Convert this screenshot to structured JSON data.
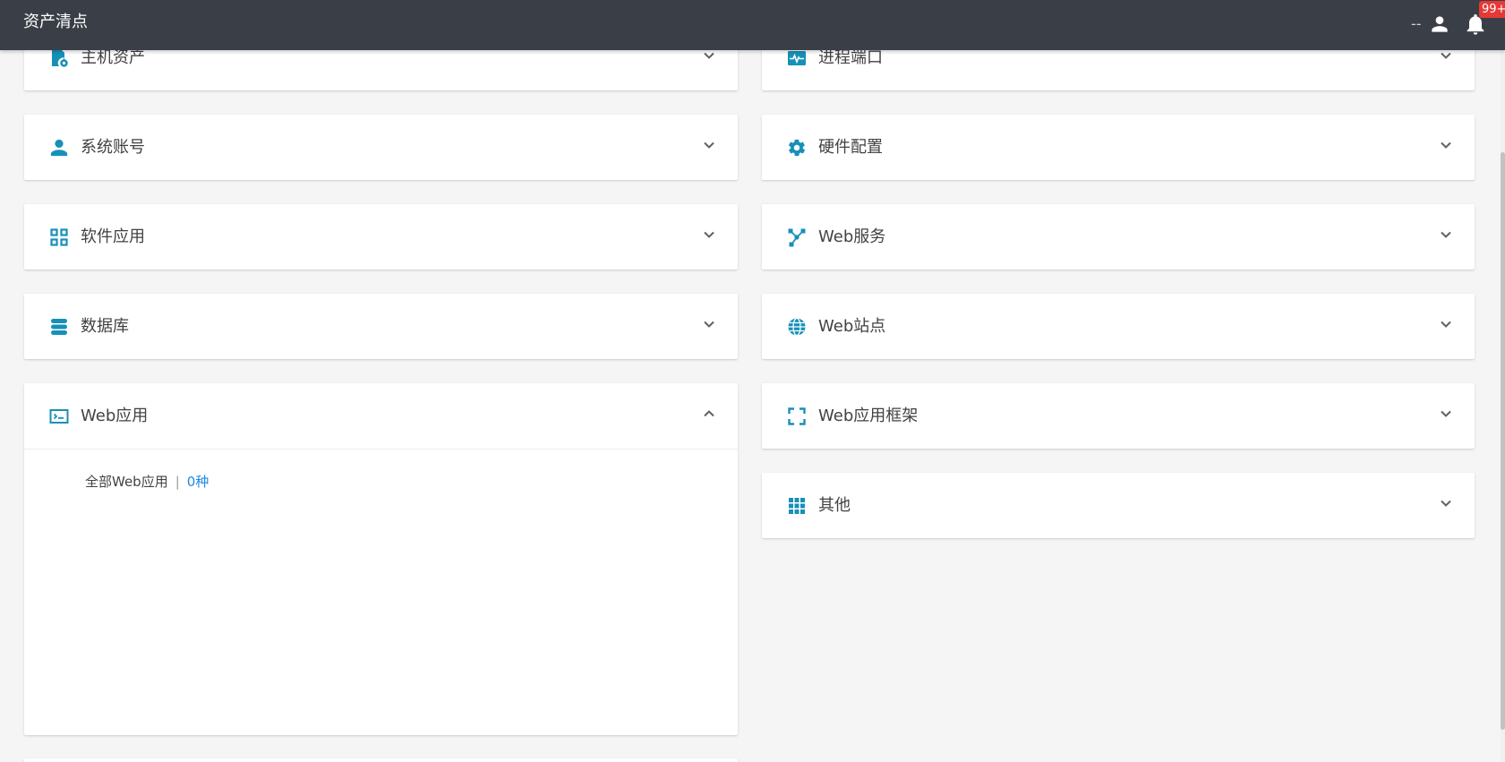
{
  "header": {
    "title": "资产清点",
    "user_name": "--",
    "notification_badge": "99+"
  },
  "colors": {
    "header_bg": "#3a3f47",
    "accent": "#1790b8",
    "link": "#1e88e5",
    "badge": "#e53935"
  },
  "left_panels": [
    {
      "title": "主机资产",
      "icon": "host-asset-icon",
      "expanded": false
    },
    {
      "title": "系统账号",
      "icon": "person-icon",
      "expanded": false
    },
    {
      "title": "软件应用",
      "icon": "apps-grid-icon",
      "expanded": false
    },
    {
      "title": "数据库",
      "icon": "database-icon",
      "expanded": false
    },
    {
      "title": "Web应用",
      "icon": "web-app-icon",
      "expanded": true,
      "summary_label": "全部Web应用",
      "summary_sep": "|",
      "summary_count": "0种"
    }
  ],
  "right_panels": [
    {
      "title": "进程端口",
      "icon": "pulse-monitor-icon",
      "expanded": false
    },
    {
      "title": "硬件配置",
      "icon": "gear-icon",
      "expanded": false
    },
    {
      "title": "Web服务",
      "icon": "network-nodes-icon",
      "expanded": false
    },
    {
      "title": "Web站点",
      "icon": "globe-icon",
      "expanded": false
    },
    {
      "title": "Web应用框架",
      "icon": "frame-corners-icon",
      "expanded": false
    },
    {
      "title": "其他",
      "icon": "dots-grid-icon",
      "expanded": false
    }
  ]
}
